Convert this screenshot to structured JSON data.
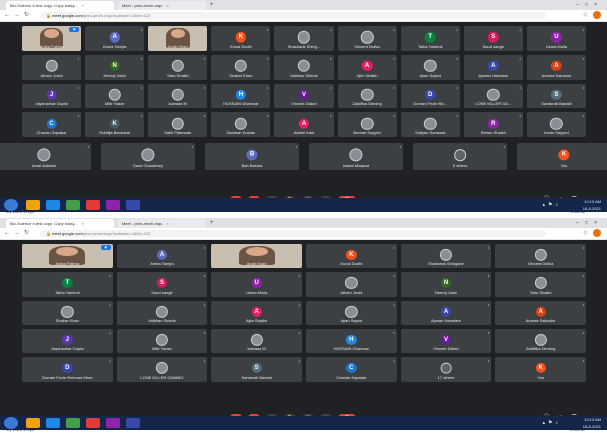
{
  "screens": [
    {
      "tabs": [
        "Bio-Science e-test copy: Copy today...",
        "Meet - pnm-amzh-mqu"
      ],
      "address": {
        "host": "meet.google.com",
        "path": "/pnm-amzh-mqu?authuser=1&hs=122"
      },
      "time_meeting": "10:13 AM  |  pnm-amzh-mqu",
      "download_file": "My video 1.mp4",
      "download_show_all": "Show all",
      "tray_time": "10:13 AM",
      "tray_date": "18-8-2021",
      "grid": {
        "cols": 9,
        "rows": 5
      },
      "tiles": [
        {
          "name": "Aniba Fatima",
          "kind": "cam",
          "pinned": true
        },
        {
          "name": "Arsha Tamjra",
          "kind": "letter",
          "letter": "A",
          "color": "#5c6bc0"
        },
        {
          "name": "Anab Khan",
          "kind": "cam"
        },
        {
          "name": "Kunal Dudhi",
          "kind": "letter",
          "letter": "K",
          "color": "#f4511e"
        },
        {
          "name": "Shashank Shing...",
          "kind": "photo"
        },
        {
          "name": "Vincent Dsilva",
          "kind": "photo"
        },
        {
          "name": "Talha Tamboli",
          "kind": "letter",
          "letter": "T",
          "color": "#0b8043"
        },
        {
          "name": "Saud sange",
          "kind": "letter",
          "letter": "S",
          "color": "#d81b60"
        },
        {
          "name": "Usma Mulla",
          "kind": "letter",
          "letter": "U",
          "color": "#8e24aa"
        },
        {
          "name": "Atharv Joshi",
          "kind": "photo"
        },
        {
          "name": "Neeraj Joshi",
          "kind": "letter",
          "letter": "N",
          "color": "#33691e"
        },
        {
          "name": "Taha Shaikh",
          "kind": "photo"
        },
        {
          "name": "Shakar Khan",
          "kind": "photo"
        },
        {
          "name": "Vaibhav Shinde",
          "kind": "photo"
        },
        {
          "name": "Ajim Shaikh",
          "kind": "letter",
          "letter": "A",
          "color": "#e91e63"
        },
        {
          "name": "Ayan Sayed",
          "kind": "photo"
        },
        {
          "name": "Ayman Hamdare",
          "kind": "letter",
          "letter": "A",
          "color": "#3949ab"
        },
        {
          "name": "Andrea Salvador",
          "kind": "letter",
          "letter": "A",
          "color": "#d84315"
        },
        {
          "name": "Jayshankar Gupta",
          "kind": "letter",
          "letter": "J",
          "color": "#5e35b1"
        },
        {
          "name": "Mitir Yadav",
          "kind": "photo"
        },
        {
          "name": "kainaaz M",
          "kind": "photo"
        },
        {
          "name": "HUSSAIN Ghamsar",
          "kind": "letter",
          "letter": "H",
          "color": "#1e88e5"
        },
        {
          "name": "Vincent Dsilari",
          "kind": "letter",
          "letter": "V",
          "color": "#6a1b9a"
        },
        {
          "name": "Zakiiflka Dinning",
          "kind": "photo"
        },
        {
          "name": "Durrani Fezle Ra...",
          "kind": "letter",
          "letter": "D",
          "color": "#3949ab"
        },
        {
          "name": "LONE KILLER GA...",
          "kind": "photo"
        },
        {
          "name": "Sanskrati Bandal",
          "kind": "letter",
          "letter": "S",
          "color": "#546e7a"
        },
        {
          "name": "Chandu Sapakar",
          "kind": "letter",
          "letter": "C",
          "color": "#1976d2"
        },
        {
          "name": "Rohitija Barankar",
          "kind": "letter",
          "letter": "K",
          "color": "#455a64"
        },
        {
          "name": "Sahil Patanade",
          "kind": "photo"
        },
        {
          "name": "Darshan Kuldan",
          "kind": "photo"
        },
        {
          "name": "Adahri Kale",
          "kind": "letter",
          "letter": "A",
          "color": "#e91e63"
        },
        {
          "name": "Burhan Sayyed",
          "kind": "photo"
        },
        {
          "name": "Sufiyan Sunwara",
          "kind": "photo"
        },
        {
          "name": "Rehan Shaikh",
          "kind": "letter",
          "letter": "R",
          "color": "#8e24aa"
        },
        {
          "name": "Imran Sayyed",
          "kind": "photo"
        }
      ],
      "bottom_row": [
        {
          "name": "Amal Ardekar",
          "kind": "photo"
        },
        {
          "name": "Saud Chaudhary",
          "kind": "photo"
        },
        {
          "name": "Ban Basma",
          "kind": "letter",
          "letter": "B",
          "color": "#5c6bc0"
        },
        {
          "name": "Inaam Maqsud",
          "kind": "photo"
        },
        {
          "name": "5 others",
          "kind": "others"
        },
        {
          "name": "You",
          "kind": "letter",
          "letter": "K",
          "color": "#f4511e"
        }
      ]
    },
    {
      "tabs": [
        "Bio-Science e-test copy: Copy today...",
        "Meet - pnm-amzh-mqu"
      ],
      "address": {
        "host": "meet.google.com",
        "path": "/pnm-amzh-mqu?authuser=1&hs=122"
      },
      "time_meeting": "10:13 AM  |  pnm-amzh-mqu",
      "download_file": "My video 1.mp4",
      "download_show_all": "Show all",
      "tray_time": "10:13 AM",
      "tray_date": "18-8-2021",
      "grid": {
        "cols": 6,
        "rows": 6
      },
      "tiles": [
        {
          "name": "Aniba Fatima",
          "kind": "cam",
          "pinned": true
        },
        {
          "name": "Arsha Tamjra",
          "kind": "letter",
          "letter": "A",
          "color": "#5c6bc0"
        },
        {
          "name": "Anab Khan",
          "kind": "cam"
        },
        {
          "name": "Kunal Dudhi",
          "kind": "letter",
          "letter": "K",
          "color": "#f4511e"
        },
        {
          "name": "Shashank Shingane",
          "kind": "photo"
        },
        {
          "name": "Vincent Dsilva",
          "kind": "photo"
        },
        {
          "name": "Talha Tamboli",
          "kind": "letter",
          "letter": "T",
          "color": "#0b8043"
        },
        {
          "name": "Saud sange",
          "kind": "letter",
          "letter": "S",
          "color": "#d81b60"
        },
        {
          "name": "Usma Mulla",
          "kind": "letter",
          "letter": "U",
          "color": "#8e24aa"
        },
        {
          "name": "Atharv Joshi",
          "kind": "photo"
        },
        {
          "name": "Neeraj Joshi",
          "kind": "letter",
          "letter": "N",
          "color": "#33691e"
        },
        {
          "name": "Taha Shaikh",
          "kind": "photo"
        },
        {
          "name": "Shakar Khan",
          "kind": "photo"
        },
        {
          "name": "Vaibhav Shinde",
          "kind": "photo"
        },
        {
          "name": "Ajim Shaikh",
          "kind": "letter",
          "letter": "A",
          "color": "#e91e63"
        },
        {
          "name": "Ayan Sayed",
          "kind": "photo"
        },
        {
          "name": "Ayman Hamdare",
          "kind": "letter",
          "letter": "A",
          "color": "#3949ab"
        },
        {
          "name": "Andrea Salvador",
          "kind": "letter",
          "letter": "A",
          "color": "#d84315"
        },
        {
          "name": "Jayshankar Gupta",
          "kind": "letter",
          "letter": "J",
          "color": "#5e35b1"
        },
        {
          "name": "Mitir Yadav",
          "kind": "photo"
        },
        {
          "name": "kainaaz M",
          "kind": "photo"
        },
        {
          "name": "HUSSAIN Ghamsar",
          "kind": "letter",
          "letter": "H",
          "color": "#1e88e5"
        },
        {
          "name": "Vincent Dsilari",
          "kind": "letter",
          "letter": "V",
          "color": "#6a1b9a"
        },
        {
          "name": "Zakiiflka Dinning",
          "kind": "photo"
        },
        {
          "name": "Durrani Fezle Rehman Khan",
          "kind": "letter",
          "letter": "D",
          "color": "#3949ab"
        },
        {
          "name": "LONE KILLER GAMING",
          "kind": "photo"
        },
        {
          "name": "Sanskrati Bandal",
          "kind": "letter",
          "letter": "S",
          "color": "#546e7a"
        },
        {
          "name": "Chandu Sapakar",
          "kind": "letter",
          "letter": "C",
          "color": "#1976d2"
        },
        {
          "name": "17 others",
          "kind": "others"
        },
        {
          "name": "You",
          "kind": "letter",
          "letter": "K",
          "color": "#f4511e"
        }
      ],
      "bottom_row": []
    }
  ],
  "controls": {
    "mic_icon": "mic-off-icon",
    "cam_icon": "cam-off-icon",
    "cc_icon": "captions-icon",
    "hand_icon": "raise-hand-icon",
    "present_icon": "present-icon",
    "more_icon": "more-icon",
    "end_icon": "end-call-icon",
    "end_color": "#ea4335",
    "accent": "#1a73e8"
  }
}
